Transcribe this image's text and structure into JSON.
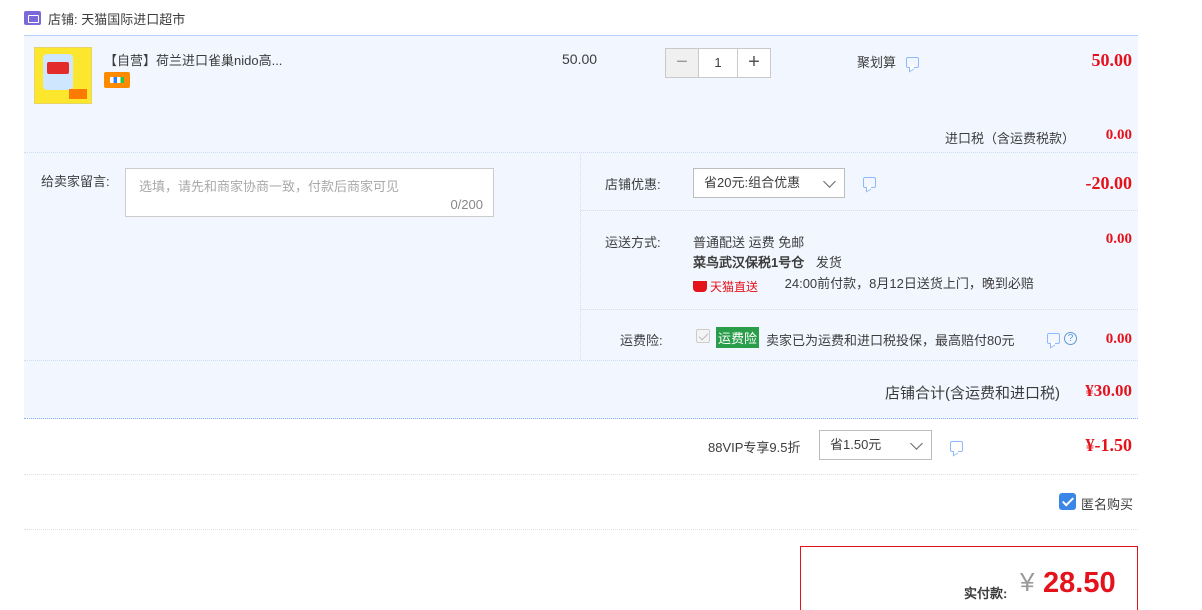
{
  "store": {
    "logo_icon": "tmall-global-icon",
    "label": "店铺: 天猫国际进口超市"
  },
  "item": {
    "title": "【自营】荷兰进口雀巢nido高...",
    "unit_price": "50.00",
    "quantity": "1",
    "minus": "−",
    "plus": "+",
    "promo_label": "聚划算",
    "subtotal": "50.00",
    "tax_label": "进口税（含运费税款）",
    "tax_value": "0.00"
  },
  "message": {
    "label": "给卖家留言:",
    "placeholder": "选填，请先和商家协商一致，付款后商家可见",
    "count": "0/200"
  },
  "discount": {
    "label": "店铺优惠:",
    "selected": "省20元:组合优惠",
    "value": "-20.00"
  },
  "shipping": {
    "label": "运送方式:",
    "method": "普通配送 运费 免邮",
    "warehouse": "菜鸟武汉保税1号仓",
    "warehouse_suffix": "发货",
    "tmall_logo_text": "天猫直送",
    "delivery_note": "24:00前付款，8月12日送货上门，晚到必赔",
    "value": "0.00"
  },
  "insurance": {
    "label": "运费险:",
    "badge": "运费险",
    "text": "卖家已为运费和进口税投保，最高赔付80元",
    "question": "?",
    "value": "0.00"
  },
  "store_total": {
    "label": "店铺合计(含运费和进口税)",
    "value": "¥30.00"
  },
  "vip": {
    "label": "88VIP专享9.5折",
    "selected": "省1.50元",
    "value": "¥-1.50"
  },
  "anonymous": {
    "label": "匿名购买",
    "checked": true
  },
  "payment": {
    "label": "实付款:",
    "currency": "¥",
    "amount": "28.50"
  },
  "colors": {
    "price_red": "#e4121b",
    "panel_bg": "#f2f7ff",
    "checkbox_blue": "#3a86e6",
    "insurance_green": "#2a9d4a"
  }
}
